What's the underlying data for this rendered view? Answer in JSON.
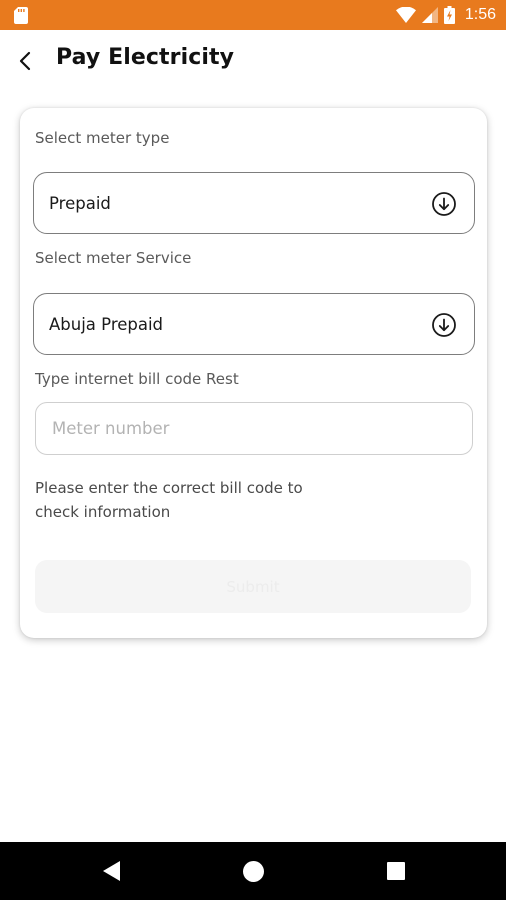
{
  "status_bar": {
    "time": "1:56",
    "background": "#e87a1e",
    "icons": [
      "sd-card-icon",
      "wifi-icon",
      "cell-signal-icon",
      "battery-icon"
    ]
  },
  "header": {
    "title": "Pay Electricity",
    "back_icon": "back-arrow-icon"
  },
  "form": {
    "meter_type_label": "Select meter type",
    "meter_type_value": "Prepaid",
    "meter_service_label": "Select meter Service",
    "meter_service_value": "Abuja Prepaid",
    "bill_code_label": "Type internet bill code Rest",
    "meter_number_placeholder": "Meter number",
    "meter_number_value": "",
    "helper_text": "Please enter the correct bill code to check information",
    "submit_label": "Submit",
    "dropdown_icon": "arrow-down-circle-icon"
  },
  "nav_bar": {
    "icons": [
      "nav-back-icon",
      "nav-home-icon",
      "nav-recents-icon"
    ]
  }
}
